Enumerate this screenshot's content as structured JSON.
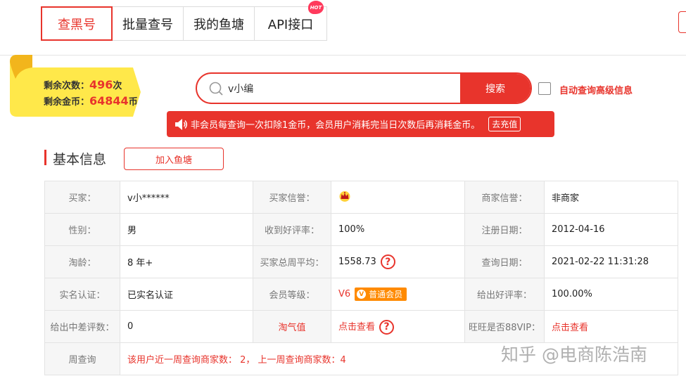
{
  "tabs": [
    {
      "label": "查黑号"
    },
    {
      "label": "批量查号"
    },
    {
      "label": "我的鱼塘"
    },
    {
      "label": "API接口",
      "badge": "HOT"
    }
  ],
  "account": {
    "remaining_times_label": "剩余次数：",
    "remaining_times": "496",
    "times_unit": "次",
    "remaining_coins_label": "剩余金币：",
    "remaining_coins": "64844",
    "coins_unit": "币"
  },
  "search": {
    "value": "v小编",
    "button": "搜索",
    "auto_query_label": "自动查询高级信息"
  },
  "notice": {
    "text": "非会员每查询一次扣除1金币，会员用户消耗完当日次数后再消耗金币。",
    "action": "去充值"
  },
  "section": {
    "title": "基本信息",
    "add_button": "加入鱼塘"
  },
  "info": {
    "buyer_label": "买家：",
    "buyer": "v小******",
    "buyer_credit_label": "买家信誉：",
    "seller_credit_label": "商家信誉：",
    "seller_credit": "非商家",
    "gender_label": "性别：",
    "gender": "男",
    "good_rate_received_label": "收到好评率：",
    "good_rate_received": "100%",
    "register_date_label": "注册日期：",
    "register_date": "2012-04-16",
    "taobao_age_label": "淘龄：",
    "taobao_age": "8 年+",
    "weekly_avg_label": "买家总周平均：",
    "weekly_avg": "1558.73",
    "query_date_label": "查询日期：",
    "query_date": "2021-02-22 11:31:28",
    "realname_label": "实名认证：",
    "realname": "已实名认证",
    "member_level_label": "会员等级：",
    "member_level": "V6",
    "member_badge": "普通会员",
    "good_rate_given_label": "给出好评率：",
    "good_rate_given": "100.00%",
    "bad_reviews_label": "给出中差评数：",
    "bad_reviews": "0",
    "taoqi_label": "淘气值",
    "taoqi_link": "点击查看",
    "wangwang_vip_label": "旺旺是否88VIP：",
    "wangwang_vip_link": "点击查看",
    "weekly_query_label": "周查询",
    "weekly_query": "该用户近一周查询商家数：  2，  上一周查询商家数：4"
  },
  "watermark": "知乎 @电商陈浩南",
  "colors": {
    "accent": "#e8342c",
    "ribbon": "#ffe84a",
    "vip_badge": "#ff8a00"
  }
}
